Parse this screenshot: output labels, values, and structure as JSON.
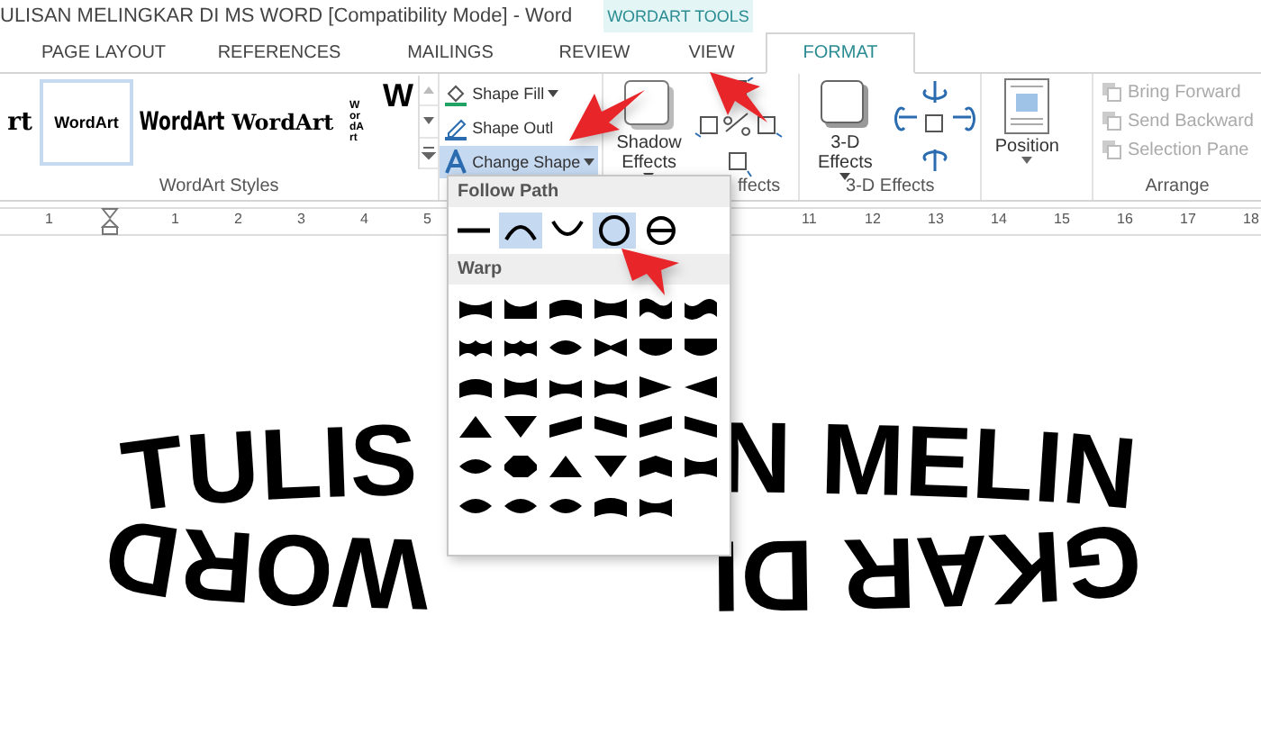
{
  "window": {
    "title": "ULISAN MELINGKAR DI MS WORD [Compatibility Mode] - Word"
  },
  "context_tab": {
    "label": "WORDART TOOLS"
  },
  "tabs": [
    {
      "label": "PAGE LAYOUT",
      "selected": false
    },
    {
      "label": "REFERENCES",
      "selected": false
    },
    {
      "label": "MAILINGS",
      "selected": false
    },
    {
      "label": "REVIEW",
      "selected": false
    },
    {
      "label": "VIEW",
      "selected": false
    },
    {
      "label": "FORMAT",
      "selected": true
    }
  ],
  "wordart_gallery": {
    "items": [
      {
        "text": "rt",
        "kind": "cut",
        "selected": false
      },
      {
        "text": "WordArt",
        "kind": "arch",
        "selected": true
      },
      {
        "text": "WordArt",
        "kind": "heavy",
        "selected": false
      },
      {
        "text": "WordArt",
        "kind": "serif",
        "selected": false
      },
      {
        "text": "WordArt",
        "kind": "vertical",
        "selected": false
      },
      {
        "text": "W",
        "kind": "block",
        "selected": false
      }
    ],
    "group_label": "WordArt Styles"
  },
  "shape_commands": [
    {
      "label": "Shape Fill",
      "kind": "fill",
      "highlighted": false
    },
    {
      "label": "Shape Outl",
      "kind": "outline",
      "highlighted": false
    },
    {
      "label": "Change Shape",
      "kind": "change",
      "highlighted": true
    }
  ],
  "shadow_button": {
    "label": "Shadow Effects"
  },
  "shadow_group_label": "ffects",
  "three_d_button": {
    "label": "3-D Effects"
  },
  "three_d_group_label": "3-D Effects",
  "position_button": {
    "label": "Position"
  },
  "arrange": {
    "items": [
      {
        "label": "Bring Forward",
        "disabled": true
      },
      {
        "label": "Send Backward",
        "disabled": true
      },
      {
        "label": "Selection Pane",
        "disabled": true
      }
    ],
    "group_label": "Arrange"
  },
  "ruler": {
    "labels": [
      "1",
      "1",
      "2",
      "3",
      "4",
      "5",
      "11",
      "12",
      "13",
      "14",
      "15",
      "16",
      "17",
      "18"
    ]
  },
  "change_shape_menu": {
    "follow_path_header": "Follow Path",
    "follow_path_items": [
      {
        "kind": "line",
        "selected": false
      },
      {
        "kind": "arch-up",
        "selected": true
      },
      {
        "kind": "arch-down",
        "selected": false
      },
      {
        "kind": "circle",
        "selected": true
      },
      {
        "kind": "button",
        "selected": false
      }
    ],
    "warp_header": "Warp"
  },
  "document": {
    "wordart_pieces": [
      "TULIS",
      "N MELIN",
      "WORD",
      "GKAR DI"
    ]
  }
}
